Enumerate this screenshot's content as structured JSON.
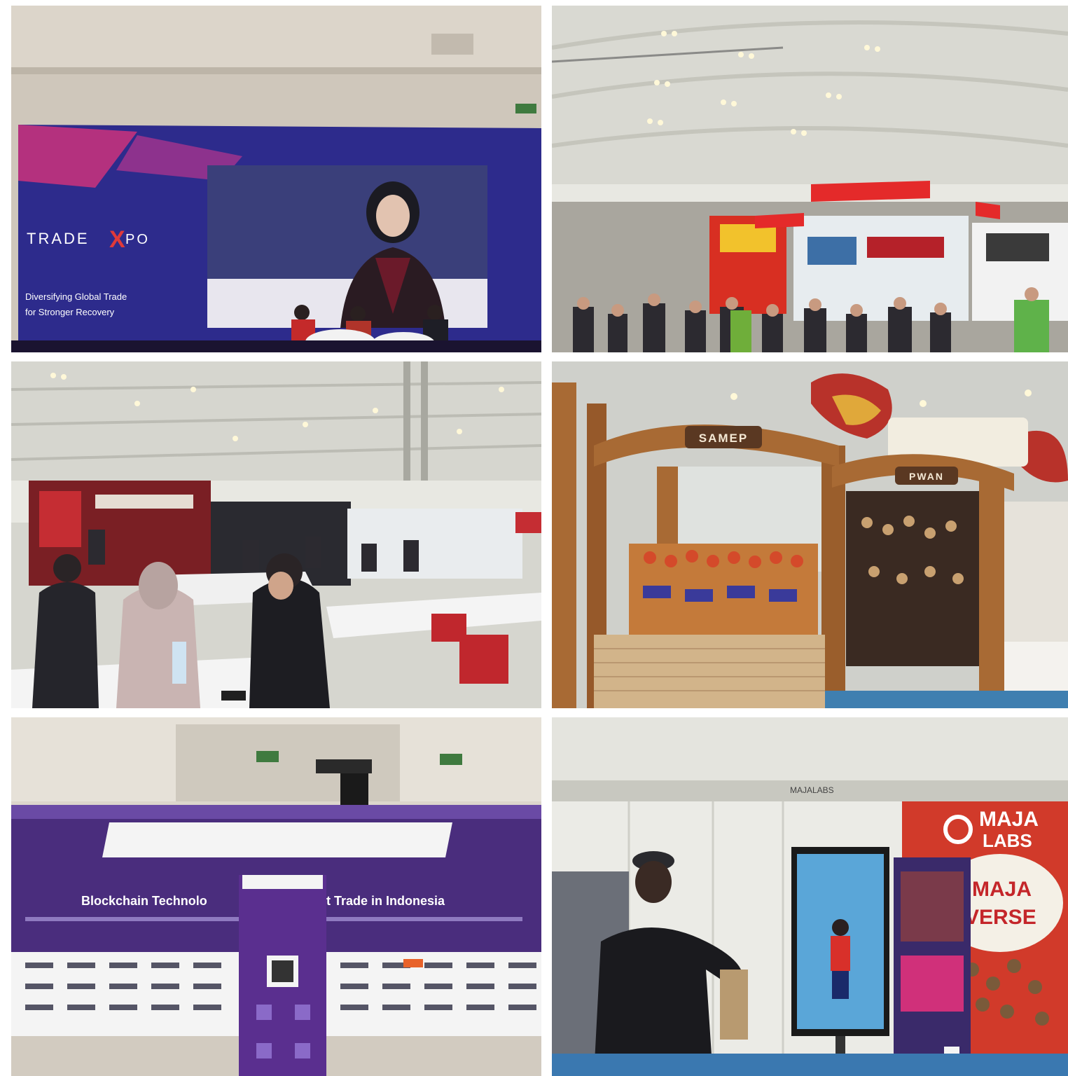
{
  "photos": [
    {
      "name": "stage-talk",
      "signs": {
        "brand": "TRADE",
        "brand_x": "X",
        "brand_po": "PO",
        "tagline_1": "Diversifying Global Trade",
        "tagline_2": "for Stronger Recovery"
      }
    },
    {
      "name": "exhibition-hall",
      "signs": {}
    },
    {
      "name": "seating-area",
      "signs": {}
    },
    {
      "name": "craft-booths",
      "signs": {
        "booth_1": "SAMEP",
        "booth_2": "PWAN"
      }
    },
    {
      "name": "backdrop-banner",
      "signs": {
        "headline_left": "Blockchain Technolo",
        "headline_right": "t Trade in Indonesia"
      }
    },
    {
      "name": "majalabs-booth",
      "signs": {
        "fascia": "MAJALABS",
        "logo_1": "MAJA",
        "logo_2": "LABS",
        "slogan_1": "MAJA",
        "slogan_2": "VERSE"
      }
    }
  ],
  "colors": {
    "stage_navy": "#2d2b8c",
    "stage_magenta": "#d6337a",
    "booth_red": "#c8232a",
    "wood": "#a86a34",
    "hall_ceiling": "#d9d9d2",
    "banner_purple": "#4a2d7d"
  }
}
